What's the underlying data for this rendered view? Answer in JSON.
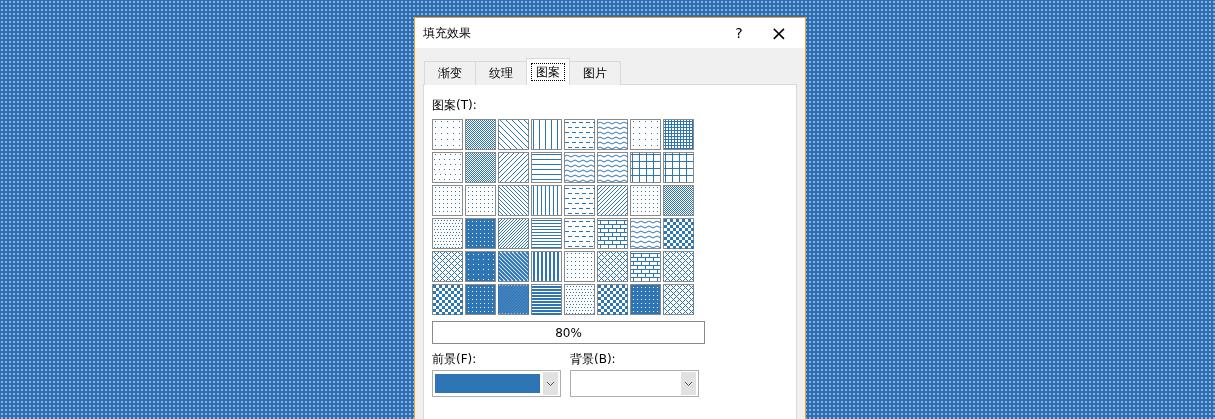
{
  "window": {
    "title": "填充效果",
    "help": "?",
    "close": "×"
  },
  "tabs": [
    {
      "label": "渐变",
      "selected": false
    },
    {
      "label": "纹理",
      "selected": false
    },
    {
      "label": "图案",
      "selected": true
    },
    {
      "label": "图片",
      "selected": false
    }
  ],
  "pattern_label": "图案(T):",
  "patterns": [
    {
      "kind": "dots"
    },
    {
      "kind": "checker"
    },
    {
      "kind": "diagdown"
    },
    {
      "kind": "vertical"
    },
    {
      "kind": "dash"
    },
    {
      "kind": "wave"
    },
    {
      "kind": "dots"
    },
    {
      "kind": "grid"
    },
    {
      "kind": "dots"
    },
    {
      "kind": "checker"
    },
    {
      "kind": "diagup"
    },
    {
      "kind": "horizontal"
    },
    {
      "kind": "wave"
    },
    {
      "kind": "wave"
    },
    {
      "kind": "grid"
    },
    {
      "kind": "grid"
    },
    {
      "kind": "dots"
    },
    {
      "kind": "dots"
    },
    {
      "kind": "diagdown"
    },
    {
      "kind": "vertical"
    },
    {
      "kind": "dash"
    },
    {
      "kind": "diagup"
    },
    {
      "kind": "dots"
    },
    {
      "kind": "checker"
    },
    {
      "kind": "dots"
    },
    {
      "kind": "inverse"
    },
    {
      "kind": "diagup"
    },
    {
      "kind": "horizontal"
    },
    {
      "kind": "dash"
    },
    {
      "kind": "brick"
    },
    {
      "kind": "wave"
    },
    {
      "kind": "checker"
    },
    {
      "kind": "lattice"
    },
    {
      "kind": "inverse"
    },
    {
      "kind": "diagdown"
    },
    {
      "kind": "vertical"
    },
    {
      "kind": "dots"
    },
    {
      "kind": "lattice"
    },
    {
      "kind": "brick"
    },
    {
      "kind": "lattice"
    },
    {
      "kind": "checker"
    },
    {
      "kind": "inverse"
    },
    {
      "kind": "diagup"
    },
    {
      "kind": "horizontal"
    },
    {
      "kind": "dots"
    },
    {
      "kind": "checker"
    },
    {
      "kind": "inverse"
    },
    {
      "kind": "lattice"
    }
  ],
  "pattern_name": "80%",
  "foreground": {
    "label": "前景(F):",
    "color": "#2e75b6"
  },
  "background": {
    "label": "背景(B):"
  }
}
